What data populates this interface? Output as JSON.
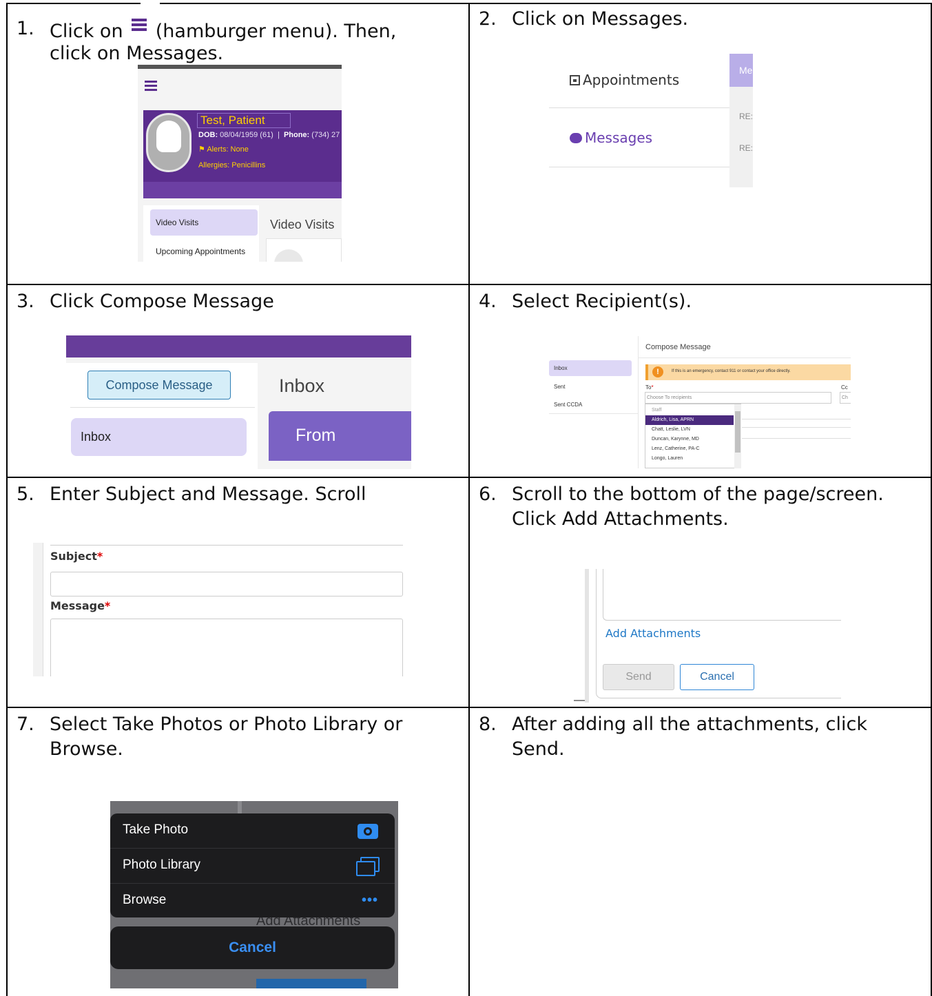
{
  "steps": [
    {
      "num": "1.",
      "text_a": "Click on",
      "text_b": "(hamburger menu).  Then,",
      "text_c": "click on Messages."
    },
    {
      "num": "2.",
      "text": "Click on Messages."
    },
    {
      "num": "3.",
      "text": "Click Compose Message"
    },
    {
      "num": "4.",
      "text": "Select Recipient(s)."
    },
    {
      "num": "5.",
      "text": "Enter Subject and Message.  Scroll"
    },
    {
      "num": "6.",
      "line1": "Scroll to the bottom of the page/screen.",
      "line2": "Click Add Attachments."
    },
    {
      "num": "7.",
      "line1": "Select Take Photos or Photo Library or",
      "line2": "Browse."
    },
    {
      "num": "8.",
      "line1": "After adding all the attachments, click",
      "line2": "Send."
    }
  ],
  "shot1": {
    "patient_name": "Test, Patient",
    "dob_label": "DOB:",
    "dob_value": "08/04/1959 (61)",
    "phone_label": "Phone:",
    "phone_value": "(734) 27",
    "alerts": "Alerts: None",
    "allergies": "Allergies: Penicillins",
    "nav_video_visits": "Video Visits",
    "nav_upcoming": "Upcoming Appointments",
    "main_heading": "Video Visits",
    "icon": "hamburger-icon"
  },
  "shot2": {
    "appointments": "Appointments",
    "messages": "Messages",
    "me": "Me",
    "re1": "RE:",
    "re2": "RE:"
  },
  "shot3": {
    "compose": "Compose Message",
    "inbox": "Inbox",
    "inbox_heading": "Inbox",
    "from": "From",
    "header_color": "#673d9a"
  },
  "shot4": {
    "title": "Compose Message",
    "nav": [
      "Inbox",
      "Sent",
      "Sent CCDA"
    ],
    "warning": "If this is an emergency, contact 911 or contact your office directly.",
    "to_label": "To",
    "cc_label": "Cc",
    "to_placeholder": "Choose To recipients",
    "cc_placeholder": "Ch",
    "recipients": [
      "Staff",
      "Aldrich, Lisa, APRN",
      "Chatt, Leslie, LVN",
      "Duncan, Karynne, MD",
      "Lenz, Catherine, PA-C",
      "Longo, Lauren"
    ],
    "selected": "Aldrich, Lisa, APRN"
  },
  "shot5": {
    "subject_label": "Subject",
    "message_label": "Message",
    "required_mark": "*"
  },
  "shot6": {
    "add_attachments": "Add Attachments",
    "send": "Send",
    "cancel": "Cancel"
  },
  "shot7": {
    "take_photo": "Take Photo",
    "photo_library": "Photo Library",
    "browse": "Browse",
    "cancel": "Cancel",
    "background_text": "Add Attachments",
    "accent": "#2f8cf0"
  }
}
